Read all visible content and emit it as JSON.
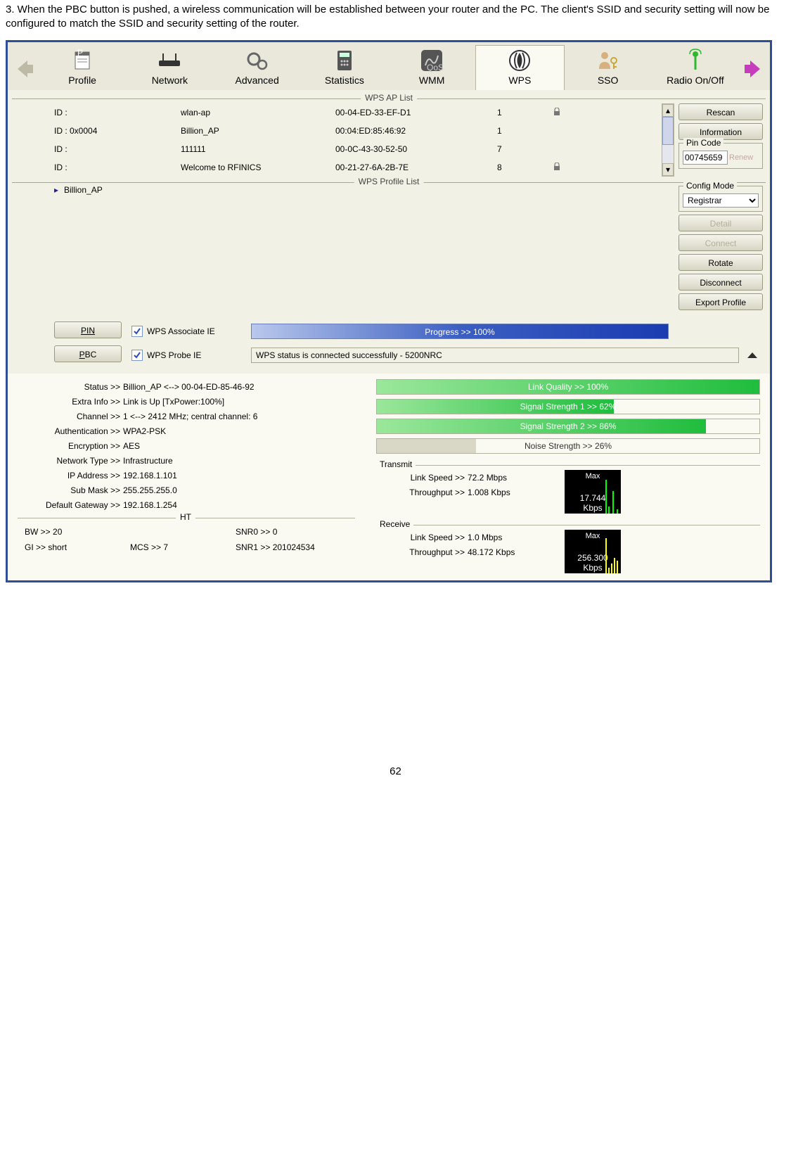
{
  "paragraph": "3.  When the PBC button is pushed, a wireless communication will be established between your router and the PC. The client's SSID and security setting will now be configured to match the SSID and security setting of the router.",
  "toolbar": {
    "items": [
      {
        "label": "Profile"
      },
      {
        "label": "Network"
      },
      {
        "label": "Advanced"
      },
      {
        "label": "Statistics"
      },
      {
        "label": "WMM"
      },
      {
        "label": "WPS"
      },
      {
        "label": "SSO"
      },
      {
        "label": "Radio On/Off"
      }
    ]
  },
  "ap_list": {
    "title": "WPS AP List",
    "rows": [
      {
        "id": "ID :",
        "ssid": "wlan-ap",
        "mac": "00-04-ED-33-EF-D1",
        "ch": "1",
        "lock": true
      },
      {
        "id": "ID : 0x0004",
        "ssid": "Billion_AP",
        "mac": "00:04:ED:85:46:92",
        "ch": "1",
        "lock": false
      },
      {
        "id": "ID :",
        "ssid": "111111",
        "mac": "00-0C-43-30-52-50",
        "ch": "7",
        "lock": false
      },
      {
        "id": "ID :",
        "ssid": "Welcome to RFINICS",
        "mac": "00-21-27-6A-2B-7E",
        "ch": "8",
        "lock": true
      }
    ]
  },
  "side_buttons": {
    "rescan": "Rescan",
    "information": "Information",
    "detail": "Detail",
    "connect": "Connect",
    "rotate": "Rotate",
    "disconnect": "Disconnect",
    "export": "Export Profile"
  },
  "pin_code": {
    "label": "Pin Code",
    "value": "00745659",
    "renew": "Renew"
  },
  "config_mode": {
    "label": "Config Mode",
    "value": "Registrar"
  },
  "profile_list": {
    "title": "WPS Profile List",
    "rows": [
      {
        "name": "Billion_AP"
      }
    ]
  },
  "lower": {
    "pin": "PIN",
    "pbc": "PBC",
    "assoc": "WPS Associate IE",
    "probe": "WPS Probe IE",
    "progress": "Progress >> 100%",
    "status": "WPS status is connected successfully - 5200NRC"
  },
  "info": {
    "status_k": "Status >>",
    "status_v": "Billion_AP <-->  00-04-ED-85-46-92",
    "extra_k": "Extra Info >>",
    "extra_v": "Link is Up [TxPower:100%]",
    "channel_k": "Channel >>",
    "channel_v": "1 <--> 2412 MHz; central channel:  6",
    "auth_k": "Authentication >>",
    "auth_v": "WPA2-PSK",
    "enc_k": "Encryption >>",
    "enc_v": "AES",
    "ntype_k": "Network Type >>",
    "ntype_v": "Infrastructure",
    "ip_k": "IP Address >>",
    "ip_v": "192.168.1.101",
    "mask_k": "Sub Mask >>",
    "mask_v": "255.255.255.0",
    "gw_k": "Default Gateway >>",
    "gw_v": "192.168.1.254"
  },
  "ht": {
    "title": "HT",
    "bw_k": "BW >>",
    "bw_v": "20",
    "snr0_k": "SNR0 >>",
    "snr0_v": "0",
    "gi_k": "GI >>",
    "gi_v": "short",
    "mcs_k": "MCS >>",
    "mcs_v": "7",
    "snr1_k": "SNR1 >>",
    "snr1_v": "201024534"
  },
  "bars": {
    "lq": "Link Quality >> 100%",
    "lq_pct": 100,
    "s1": "Signal Strength 1 >> 62%",
    "s1_pct": 62,
    "s2": "Signal Strength 2 >> 86%",
    "s2_pct": 86,
    "ns": "Noise Strength >> 26%",
    "ns_pct": 26
  },
  "transmit": {
    "title": "Transmit",
    "ls_k": "Link Speed >>",
    "ls_v": "72.2 Mbps",
    "tp_k": "Throughput >>",
    "tp_v": "1.008 Kbps",
    "max": "Max",
    "maxv": "17.744",
    "unit": "Kbps"
  },
  "receive": {
    "title": "Receive",
    "ls_k": "Link Speed >>",
    "ls_v": "1.0 Mbps",
    "tp_k": "Throughput >>",
    "tp_v": "48.172 Kbps",
    "max": "Max",
    "maxv": "256.300",
    "unit": "Kbps"
  },
  "page": "62"
}
